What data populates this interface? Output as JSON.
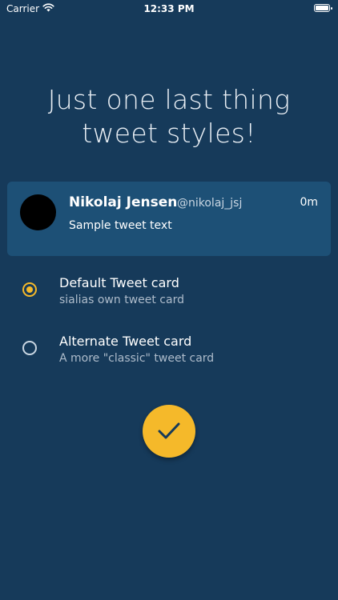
{
  "status_bar": {
    "carrier": "Carrier",
    "time": "12:33 PM"
  },
  "title": {
    "line1": "Just one last thing",
    "line2": "tweet styles!"
  },
  "tweet": {
    "name": "Nikolaj Jensen",
    "handle": "@nikolaj_jsj",
    "time": "0m",
    "text": "Sample tweet text"
  },
  "options": [
    {
      "label": "Default Tweet card",
      "subtitle": "sialias own tweet card",
      "selected": true
    },
    {
      "label": "Alternate Tweet card",
      "subtitle": "A more \"classic\" tweet card",
      "selected": false
    }
  ],
  "colors": {
    "background": "#163a5a",
    "card": "#1d5076",
    "accent": "#f5b92a"
  },
  "icons": {
    "wifi": "wifi-icon",
    "battery": "battery-icon",
    "confirm": "checkmark-icon"
  }
}
